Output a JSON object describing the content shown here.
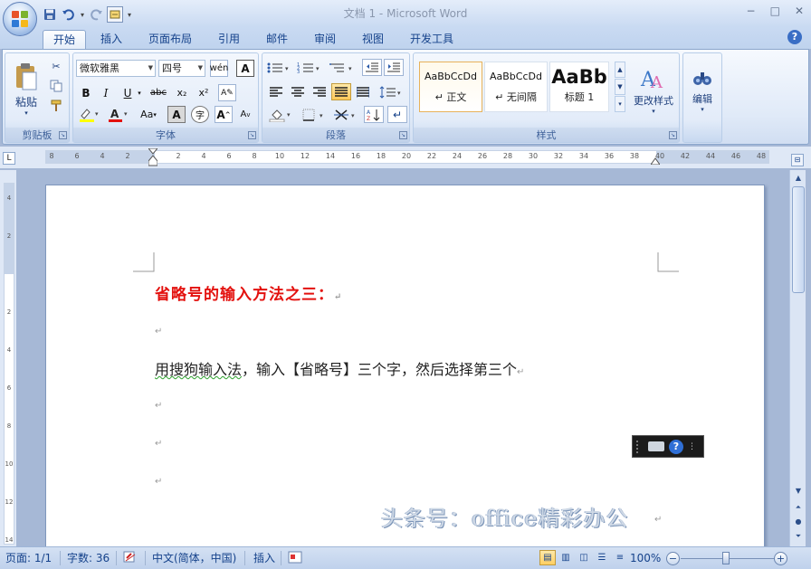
{
  "window": {
    "title": "文档 1 - Microsoft Word",
    "controls": [
      "−",
      "□",
      "✕"
    ]
  },
  "qat": {
    "icons": [
      "save-icon",
      "undo-icon",
      "redo-icon",
      "customize-icon"
    ]
  },
  "tabs": [
    "开始",
    "插入",
    "页面布局",
    "引用",
    "邮件",
    "审阅",
    "视图",
    "开发工具"
  ],
  "active_tab": "开始",
  "ribbon": {
    "clipboard": {
      "paste_label": "粘贴",
      "group_label": "剪贴板"
    },
    "font": {
      "font_name": "微软雅黑",
      "font_size": "四号",
      "buttons": [
        "B",
        "I",
        "U",
        "abc",
        "x₂",
        "x²"
      ],
      "group_label": "字体",
      "change_case": "Aa",
      "grow": "A",
      "shrink": "A"
    },
    "paragraph": {
      "group_label": "段落"
    },
    "styles": {
      "items": [
        {
          "sample": "AaBbCcDd",
          "name": "↵ 正文"
        },
        {
          "sample": "AaBbCcDd",
          "name": "↵ 无间隔"
        },
        {
          "sample": "AaBb",
          "name": "标题 1"
        }
      ],
      "change_styles": "更改样式",
      "group_label": "样式"
    },
    "editing": {
      "label": "编辑"
    }
  },
  "ruler": {
    "h_numbers": [
      "8",
      "6",
      "4",
      "2",
      "",
      "2",
      "4",
      "6",
      "8",
      "10",
      "12",
      "14",
      "16",
      "18",
      "20",
      "22",
      "24",
      "26",
      "28",
      "30",
      "32",
      "34",
      "36",
      "38",
      "40",
      "42",
      "44",
      "46",
      "48"
    ],
    "v_numbers": [
      "4",
      "2",
      "",
      "2",
      "4",
      "6",
      "8",
      "10",
      "12",
      "14"
    ]
  },
  "document": {
    "heading": "省略号的输入方法之三：",
    "body1_a": "用搜狗输入法",
    "body1_b": "，输入【省略号】三个字，然后选择第三个",
    "para_mark": "↵",
    "watermark": "头条号：office精彩办公"
  },
  "statusbar": {
    "page": "页面: 1/1",
    "words": "字数: 36",
    "language": "中文(简体，中国)",
    "mode": "插入",
    "zoom": "100%"
  }
}
